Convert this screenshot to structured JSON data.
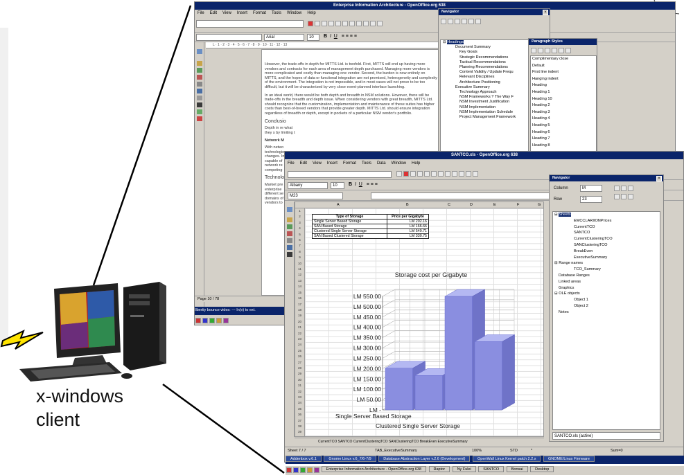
{
  "client": {
    "label_line1": "x-windows",
    "label_line2": "client"
  },
  "writer": {
    "title": "Enterprise Information Architecture - OpenOffice.org 638",
    "menu": [
      "File",
      "Edit",
      "View",
      "Insert",
      "Format",
      "Tools",
      "Window",
      "Help"
    ],
    "font_name": "Arial",
    "font_size": "10",
    "status": "Page 10 / 78",
    "paragraphs": [
      "However, the trade-offs in depth for MITTS Ltd. is twofold. First, MITTS will end up having more vendors and contracts for each area of management depth purchased. Managing more vendors is more complicated and costly than managing one vendor. Second, the burden is now entirely on MITTS, and the hopes of data or functional integration are not promised, heterogeneity and complexity of the environment. The integration is not impossible, and in most cases will not prove to be too difficult, but it will be characterized by very close event-planned interface launching.",
      "In an ideal world, there would be both depth and breadth in NSM solutions. However, there will be trade-offs in the breadth and depth issue. When considering vendors with great breadth, MITTS Ltd. should recognize that the customization, implementation and maintenance of these suites has higher costs than best-of-breed vendors that provide greater depth. MITTS Ltd. should ensure integration regardless of breadth or depth, except in pockets of a particular NSM vendor's portfolio."
    ],
    "heading_conclusion": "Conclusio",
    "conclusion_text": "Depth in re what they s by limiting t",
    "heading_network": "Network M",
    "network_text": "With netwo technologie changes. In capable of network re competing",
    "heading_tech": "Technolog",
    "tech_text": "Market pre enterprise different se domains of vendors to"
  },
  "navigator": {
    "title": "Navigator",
    "headings_label": "Headings",
    "items": [
      "Document Summary",
      "Key Goals",
      "Strategic Recommendations",
      "Tactical Recommendations",
      "Planning Recommendations",
      "Content Validity / Update Frequ",
      "Relevant Disciplines",
      "Architecture Positioning",
      "Executive Summary",
      "Technology Approach",
      "NSM Frameworks ? The Way F",
      "NSM Investment Justification",
      "NSM Implementation",
      "NSM Implementation Schedule",
      "Project Management Framework"
    ]
  },
  "styles": {
    "title": "Paragraph Styles",
    "items": [
      "Complimentary close",
      "Default",
      "First line indent",
      "Hanging indent",
      "Heading",
      "Heading 1",
      "Heading 10",
      "Heading 2",
      "Heading 3",
      "Heading 4",
      "Heading 5",
      "Heading 6",
      "Heading 7",
      "Heading 8"
    ]
  },
  "calc": {
    "title": "SANTCO.xls - OpenOffice.org 638",
    "menu": [
      "File",
      "Edit",
      "View",
      "Insert",
      "Format",
      "Tools",
      "Data",
      "Window",
      "Help"
    ],
    "font_name": "Albany",
    "font_size": "10",
    "cell_ref": "M23",
    "columns": [
      "A",
      "B",
      "C",
      "D",
      "E",
      "F",
      "G"
    ],
    "table_headers": [
      "Type of Storage",
      "Price per Gigabyte"
    ],
    "table_rows": [
      [
        "Single Server Based Storage",
        "LM 202.16"
      ],
      [
        "SAN Based Storage",
        "LM 166.66"
      ],
      [
        "Clustered Single Server Storage",
        "LM 549.71"
      ],
      [
        "SAN Based Clustered Storage",
        "LM 330.75"
      ]
    ],
    "sheet_tabs": "CurrentTCO SANTCO CurrentClusteringTCO SANClusteringTCO BreakEven ExecutiveSummary",
    "status": [
      "Sheet 7 / 7",
      "TAB_ExecutiveSummary",
      "100%",
      "STD",
      "*",
      "Sum=0"
    ]
  },
  "chart_data": {
    "type": "bar",
    "title": "Storage cost per Gigabyte",
    "categories": [
      "Single Server Based Storage",
      "SAN Based Storage",
      "Clustered Single Server Storage",
      "SAN Based Clustered Storage"
    ],
    "values": [
      202.16,
      166.66,
      549.71,
      330.75
    ],
    "xtick_labels_visible": [
      "Single Server Based Storage",
      "Clustered Single Server Storage"
    ],
    "yticks": [
      "LM -",
      "LM 50.00",
      "LM 100.00",
      "LM 150.00",
      "LM 200.00",
      "LM 250.00",
      "LM 300.00",
      "LM 350.00",
      "LM 400.00",
      "LM 450.00",
      "LM 500.00",
      "LM 550.00"
    ],
    "ylim": [
      0,
      550
    ],
    "bar_color": "#8a8ee0",
    "grid": true
  },
  "calc_navigator": {
    "title": "Navigator",
    "column_label": "Column",
    "column_value": "M",
    "row_label": "Row",
    "row_value": "23",
    "sheets_label": "Sheets",
    "sheets": [
      "EMCCLARIIONPrices",
      "CurrentTCO",
      "SANTCO",
      "CurrentClusteringTCO",
      "SANClusteringTCO",
      "BreakEven",
      "ExecutiveSummary"
    ],
    "range_names_label": "Range names",
    "range_names": [
      "TCO_Summary"
    ],
    "database_ranges": "Database Ranges",
    "linked_areas": "Linked areas",
    "graphics": "Graphics",
    "ole_label": "OLE objects",
    "ole_items": [
      "Object 1",
      "Object 2"
    ],
    "notes": "Notes",
    "doc_select": "SANTCO.xls (active)"
  },
  "taskbar": {
    "items1": [
      "Addenbox v.6.1",
      "Gnome Linux v.6_7/6-7/9",
      "Database Abstraction Layer v.2.6 (Development)",
      "OpenWall Linux Kernel patch 2.2.x",
      "GNOME/Linux Firmware"
    ],
    "items2": [
      "Enterprise Information Architecture - OpenOffice.org 638",
      "Raptor",
      "Ny Fulei",
      "SANTCO",
      "Bonsai",
      "Desktop"
    ],
    "writer_task": "Ilbertiy bounce vides: --- In(v) to ext."
  },
  "colors": {
    "titlebar": "#0a246a",
    "chart_bar": "#8a8ee0",
    "lightning": "#ffe400"
  }
}
